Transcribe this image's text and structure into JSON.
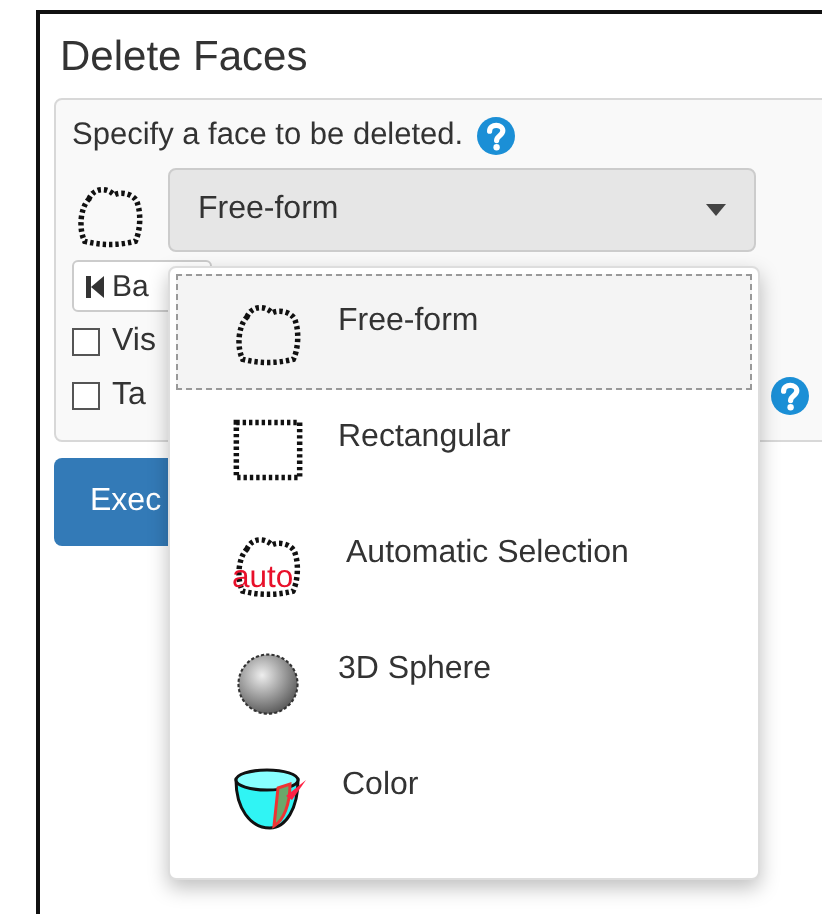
{
  "title": "Delete Faces",
  "panel": {
    "prompt": "Specify a face to be deleted.",
    "select": {
      "value": "Free-form",
      "options": [
        {
          "label": "Free-form",
          "kind": "freeform",
          "selected": true
        },
        {
          "label": "Rectangular",
          "kind": "rectangle",
          "selected": false
        },
        {
          "label": "Automatic Selection",
          "kind": "auto",
          "badge": "auto",
          "selected": false
        },
        {
          "label": "3D Sphere",
          "kind": "sphere",
          "selected": false
        },
        {
          "label": "Color",
          "kind": "color",
          "selected": false
        }
      ]
    },
    "back_button": "Ba",
    "checkboxes": [
      {
        "label": "Vis",
        "checked": false,
        "help": false
      },
      {
        "label": "Ta",
        "checked": false,
        "help": true
      }
    ]
  },
  "execute_button": "Exec"
}
